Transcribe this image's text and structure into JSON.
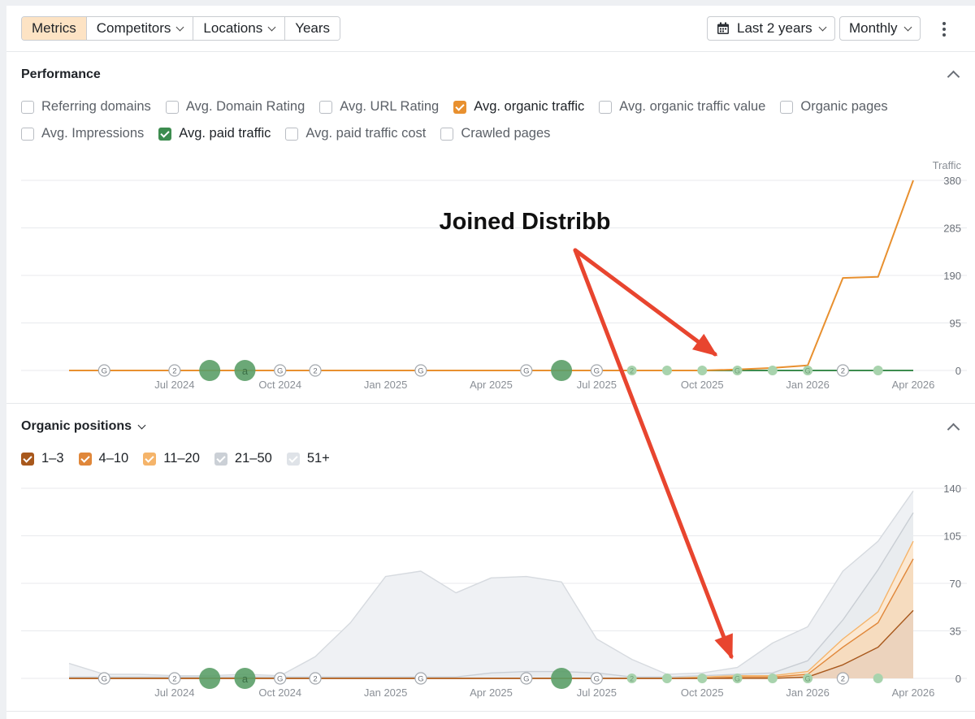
{
  "toolbar": {
    "tabs": [
      {
        "label": "Metrics",
        "dropdown": false,
        "active": true
      },
      {
        "label": "Competitors",
        "dropdown": true,
        "active": false
      },
      {
        "label": "Locations",
        "dropdown": true,
        "active": false
      },
      {
        "label": "Years",
        "dropdown": false,
        "active": false
      }
    ],
    "date_range": "Last 2 years",
    "interval": "Monthly"
  },
  "colors": {
    "organic": "#e8902f",
    "paid": "#3d8c4f",
    "annotation_arrow": "#e8452f",
    "gray_area": "#e3e6ea",
    "pos_1_3": "#a8581c",
    "pos_4_10": "#e0873a",
    "pos_11_20": "#f5b46a"
  },
  "performance": {
    "title": "Performance",
    "metrics": [
      {
        "label": "Referring domains",
        "checked": false
      },
      {
        "label": "Avg. Domain Rating",
        "checked": false
      },
      {
        "label": "Avg. URL Rating",
        "checked": false
      },
      {
        "label": "Avg. organic traffic",
        "checked": true,
        "color": "#e8902f"
      },
      {
        "label": "Avg. organic traffic value",
        "checked": false
      },
      {
        "label": "Organic pages",
        "checked": false
      },
      {
        "label": "Avg. Impressions",
        "checked": false
      },
      {
        "label": "Avg. paid traffic",
        "checked": true,
        "color": "#3d8c4f"
      },
      {
        "label": "Avg. paid traffic cost",
        "checked": false
      },
      {
        "label": "Crawled pages",
        "checked": false
      }
    ]
  },
  "annotation": {
    "text": "Joined Distribb"
  },
  "positions_section": {
    "title": "Organic positions",
    "legend": [
      {
        "label": "1–3",
        "color": "#a8581c",
        "checked": true
      },
      {
        "label": "4–10",
        "color": "#e0873a",
        "checked": true
      },
      {
        "label": "11–20",
        "color": "#f5b46a",
        "checked": true
      },
      {
        "label": "21–50",
        "color": "#cbd0d6",
        "checked": true
      },
      {
        "label": "51+",
        "color": "#dfe3e8",
        "checked": true
      }
    ]
  },
  "chart_data": [
    {
      "type": "line",
      "ylabel": "Traffic",
      "ylim": [
        0,
        380
      ],
      "y_ticks": [
        0,
        95,
        190,
        285,
        380
      ],
      "x_tick_labels": [
        "Jul 2024",
        "Oct 2024",
        "Jan 2025",
        "Apr 2025",
        "Jul 2025",
        "Oct 2025",
        "Jan 2026",
        "Apr 2026"
      ],
      "x": [
        "Apr 2024",
        "May 2024",
        "Jun 2024",
        "Jul 2024",
        "Aug 2024",
        "Sep 2024",
        "Oct 2024",
        "Nov 2024",
        "Dec 2024",
        "Jan 2025",
        "Feb 2025",
        "Mar 2025",
        "Apr 2025",
        "May 2025",
        "Jun 2025",
        "Jul 2025",
        "Aug 2025",
        "Sep 2025",
        "Oct 2025",
        "Nov 2025",
        "Dec 2025",
        "Jan 2026",
        "Feb 2026",
        "Mar 2026",
        "Apr 2026"
      ],
      "grid": true,
      "series": [
        {
          "name": "Avg. organic traffic",
          "values": [
            0,
            0,
            0,
            0,
            0,
            0,
            0,
            0,
            0,
            0,
            0,
            0,
            0,
            0,
            0,
            0,
            0,
            0,
            0,
            2,
            5,
            10,
            185,
            187,
            380
          ]
        },
        {
          "name": "Avg. paid traffic",
          "values": [
            0,
            0,
            0,
            0,
            0,
            0,
            0,
            0,
            0,
            0,
            0,
            0,
            0,
            0,
            0,
            0,
            0,
            0,
            0,
            0,
            0,
            0,
            0,
            0,
            0
          ]
        }
      ],
      "events": [
        {
          "x": "May 2024",
          "label": "G",
          "kind": "marker"
        },
        {
          "x": "Jul 2024",
          "label": "2",
          "kind": "marker"
        },
        {
          "x": "Aug 2024",
          "label": "",
          "kind": "big"
        },
        {
          "x": "Sep 2024",
          "label": "a",
          "kind": "big"
        },
        {
          "x": "Oct 2024",
          "label": "G",
          "kind": "marker"
        },
        {
          "x": "Nov 2024",
          "label": "2",
          "kind": "marker"
        },
        {
          "x": "Feb 2025",
          "label": "G",
          "kind": "marker"
        },
        {
          "x": "May 2025",
          "label": "G",
          "kind": "marker"
        },
        {
          "x": "Jun 2025",
          "label": "",
          "kind": "big"
        },
        {
          "x": "Jul 2025",
          "label": "G",
          "kind": "marker"
        },
        {
          "x": "Aug 2025",
          "label": "2",
          "kind": "small"
        },
        {
          "x": "Sep 2025",
          "label": "",
          "kind": "small"
        },
        {
          "x": "Oct 2025",
          "label": "",
          "kind": "small"
        },
        {
          "x": "Nov 2025",
          "label": "G",
          "kind": "small"
        },
        {
          "x": "Dec 2025",
          "label": "",
          "kind": "small"
        },
        {
          "x": "Jan 2026",
          "label": "G",
          "kind": "small"
        },
        {
          "x": "Feb 2026",
          "label": "2",
          "kind": "marker"
        },
        {
          "x": "Mar 2026",
          "label": "",
          "kind": "small"
        }
      ]
    },
    {
      "type": "area",
      "ylim": [
        0,
        140
      ],
      "y_ticks": [
        0,
        35,
        70,
        105,
        140
      ],
      "x_tick_labels": [
        "Jul 2024",
        "Oct 2024",
        "Jan 2025",
        "Apr 2025",
        "Jul 2025",
        "Oct 2025",
        "Jan 2026",
        "Apr 2026"
      ],
      "x": [
        "Apr 2024",
        "May 2024",
        "Jun 2024",
        "Jul 2024",
        "Aug 2024",
        "Sep 2024",
        "Oct 2024",
        "Nov 2024",
        "Dec 2024",
        "Jan 2025",
        "Feb 2025",
        "Mar 2025",
        "Apr 2025",
        "May 2025",
        "Jun 2025",
        "Jul 2025",
        "Aug 2025",
        "Sep 2025",
        "Oct 2025",
        "Nov 2025",
        "Dec 2025",
        "Jan 2026",
        "Feb 2026",
        "Mar 2026",
        "Apr 2026"
      ],
      "grid": true,
      "series": [
        {
          "name": "1–3",
          "values": [
            0,
            0,
            0,
            0,
            0,
            0,
            0,
            0,
            0,
            0,
            0,
            0,
            0,
            0,
            0,
            0,
            0,
            0,
            0,
            0,
            0,
            1,
            10,
            23,
            50
          ]
        },
        {
          "name": "4–10",
          "values": [
            0,
            0,
            0,
            0,
            0,
            0,
            0,
            0,
            0,
            0,
            0,
            0,
            0,
            0,
            0,
            0,
            0,
            0,
            0,
            1,
            1,
            2,
            13,
            18,
            38
          ]
        },
        {
          "name": "11–20",
          "values": [
            0,
            0,
            0,
            0,
            0,
            0,
            0,
            0,
            0,
            0,
            0,
            0,
            0,
            0,
            0,
            0,
            0,
            0,
            1,
            1,
            1,
            2,
            6,
            8,
            13
          ]
        },
        {
          "name": "21–50",
          "values": [
            1,
            1,
            1,
            1,
            1,
            1,
            1,
            1,
            1,
            1,
            1,
            1,
            4,
            5,
            5,
            4,
            1,
            1,
            1,
            1,
            2,
            8,
            14,
            31,
            21
          ]
        },
        {
          "name": "51+",
          "values": [
            10,
            2,
            2,
            1,
            1,
            2,
            1,
            15,
            40,
            74,
            78,
            62,
            70,
            70,
            66,
            25,
            13,
            2,
            2,
            5,
            22,
            25,
            36,
            21,
            16
          ]
        }
      ],
      "events": [
        {
          "x": "May 2024",
          "label": "G",
          "kind": "marker"
        },
        {
          "x": "Jul 2024",
          "label": "2",
          "kind": "marker"
        },
        {
          "x": "Aug 2024",
          "label": "",
          "kind": "big"
        },
        {
          "x": "Sep 2024",
          "label": "a",
          "kind": "big"
        },
        {
          "x": "Oct 2024",
          "label": "G",
          "kind": "marker"
        },
        {
          "x": "Nov 2024",
          "label": "2",
          "kind": "marker"
        },
        {
          "x": "Feb 2025",
          "label": "G",
          "kind": "marker"
        },
        {
          "x": "May 2025",
          "label": "G",
          "kind": "marker"
        },
        {
          "x": "Jun 2025",
          "label": "",
          "kind": "big"
        },
        {
          "x": "Jul 2025",
          "label": "G",
          "kind": "marker"
        },
        {
          "x": "Aug 2025",
          "label": "2",
          "kind": "small"
        },
        {
          "x": "Sep 2025",
          "label": "",
          "kind": "small"
        },
        {
          "x": "Oct 2025",
          "label": "",
          "kind": "small"
        },
        {
          "x": "Nov 2025",
          "label": "G",
          "kind": "small"
        },
        {
          "x": "Dec 2025",
          "label": "",
          "kind": "small"
        },
        {
          "x": "Jan 2026",
          "label": "G",
          "kind": "small"
        },
        {
          "x": "Feb 2026",
          "label": "2",
          "kind": "marker"
        },
        {
          "x": "Mar 2026",
          "label": "",
          "kind": "small"
        }
      ]
    }
  ]
}
